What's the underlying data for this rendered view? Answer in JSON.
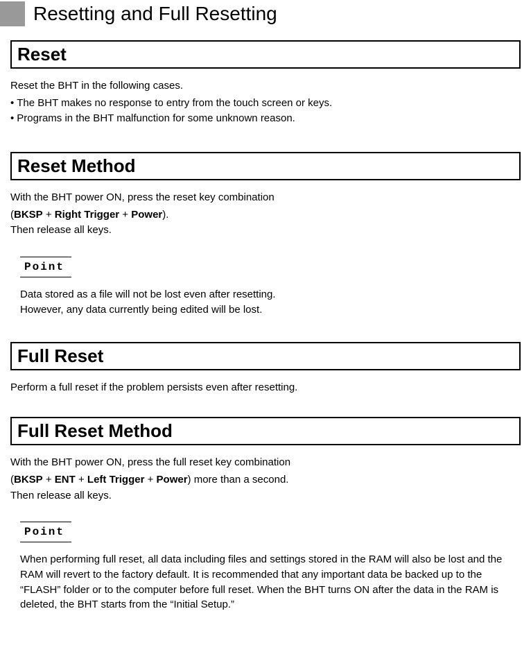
{
  "header": {
    "title": "Resetting and Full Resetting"
  },
  "sections": {
    "reset": {
      "heading": "Reset",
      "intro": "Reset the BHT in the following cases.",
      "bullet1": "The BHT makes no response to entry from the touch screen or keys.",
      "bullet2": "Programs in the BHT malfunction for some unknown reason."
    },
    "resetMethod": {
      "heading": "Reset Method",
      "line1": "With the BHT power ON, press the reset key combination",
      "combo": {
        "openParen": "(",
        "k1": "BKSP",
        "plus1": " + ",
        "k2": "Right Trigger",
        "plus2": " + ",
        "k3": "Power",
        "closeParen": ")."
      },
      "line3": "Then release all keys.",
      "point": {
        "label": "Point",
        "body1": "Data stored as a file will not be lost even after resetting.",
        "body2": "However, any data currently being edited will be lost."
      }
    },
    "fullReset": {
      "heading": "Full Reset",
      "body": "Perform a full reset if the problem persists even after resetting."
    },
    "fullResetMethod": {
      "heading": "Full Reset Method",
      "line1": "With the BHT power ON, press the full reset key combination",
      "combo": {
        "openParen": "(",
        "k1": "BKSP",
        "plus1": " + ",
        "k2": "ENT",
        "plus2": " + ",
        "k3": "Left Trigger",
        "plus3": " + ",
        "k4": "Power",
        "closeParen": ") more than a second."
      },
      "line3": "Then release all keys.",
      "point": {
        "label": "Point",
        "body": "When performing full reset, all data including files and settings stored in the RAM will also be lost and the RAM will revert to the factory default. It is recommended that any important data be backed up to the “FLASH” folder or to the computer before full reset. When the BHT turns ON after the data in the RAM is deleted, the BHT starts from the “Initial Setup.”"
      }
    }
  }
}
